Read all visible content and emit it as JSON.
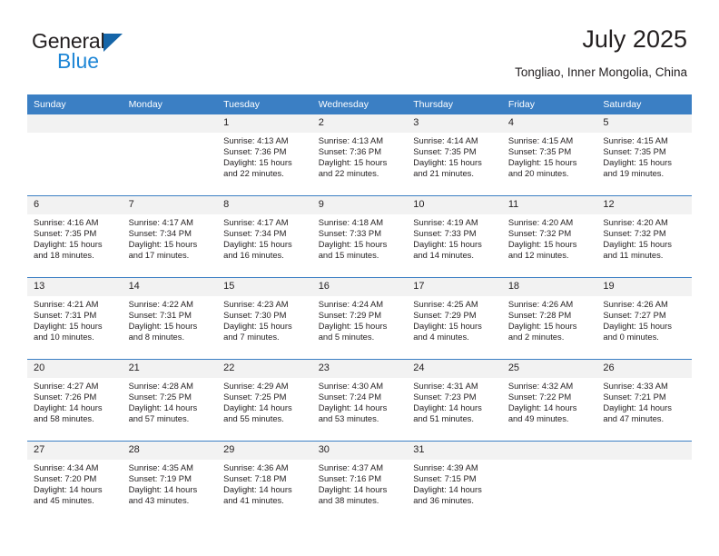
{
  "brand": {
    "name_part1": "General",
    "name_part2": "Blue",
    "logo_icon": "triangle-logo-icon",
    "accent_color": "#1e86d6",
    "triangle_color": "#1565a8"
  },
  "header": {
    "title": "July 2025",
    "subtitle": "Tongliao, Inner Mongolia, China"
  },
  "calendar": {
    "header_bg": "#3b7fc4",
    "daynum_bg": "#f2f2f2",
    "weekdays": [
      "Sunday",
      "Monday",
      "Tuesday",
      "Wednesday",
      "Thursday",
      "Friday",
      "Saturday"
    ],
    "weeks": [
      [
        {
          "day": "",
          "sunrise": "",
          "sunset": "",
          "daylight_line1": "",
          "daylight_line2": ""
        },
        {
          "day": "",
          "sunrise": "",
          "sunset": "",
          "daylight_line1": "",
          "daylight_line2": ""
        },
        {
          "day": "1",
          "sunrise": "Sunrise: 4:13 AM",
          "sunset": "Sunset: 7:36 PM",
          "daylight_line1": "Daylight: 15 hours",
          "daylight_line2": "and 22 minutes."
        },
        {
          "day": "2",
          "sunrise": "Sunrise: 4:13 AM",
          "sunset": "Sunset: 7:36 PM",
          "daylight_line1": "Daylight: 15 hours",
          "daylight_line2": "and 22 minutes."
        },
        {
          "day": "3",
          "sunrise": "Sunrise: 4:14 AM",
          "sunset": "Sunset: 7:35 PM",
          "daylight_line1": "Daylight: 15 hours",
          "daylight_line2": "and 21 minutes."
        },
        {
          "day": "4",
          "sunrise": "Sunrise: 4:15 AM",
          "sunset": "Sunset: 7:35 PM",
          "daylight_line1": "Daylight: 15 hours",
          "daylight_line2": "and 20 minutes."
        },
        {
          "day": "5",
          "sunrise": "Sunrise: 4:15 AM",
          "sunset": "Sunset: 7:35 PM",
          "daylight_line1": "Daylight: 15 hours",
          "daylight_line2": "and 19 minutes."
        }
      ],
      [
        {
          "day": "6",
          "sunrise": "Sunrise: 4:16 AM",
          "sunset": "Sunset: 7:35 PM",
          "daylight_line1": "Daylight: 15 hours",
          "daylight_line2": "and 18 minutes."
        },
        {
          "day": "7",
          "sunrise": "Sunrise: 4:17 AM",
          "sunset": "Sunset: 7:34 PM",
          "daylight_line1": "Daylight: 15 hours",
          "daylight_line2": "and 17 minutes."
        },
        {
          "day": "8",
          "sunrise": "Sunrise: 4:17 AM",
          "sunset": "Sunset: 7:34 PM",
          "daylight_line1": "Daylight: 15 hours",
          "daylight_line2": "and 16 minutes."
        },
        {
          "day": "9",
          "sunrise": "Sunrise: 4:18 AM",
          "sunset": "Sunset: 7:33 PM",
          "daylight_line1": "Daylight: 15 hours",
          "daylight_line2": "and 15 minutes."
        },
        {
          "day": "10",
          "sunrise": "Sunrise: 4:19 AM",
          "sunset": "Sunset: 7:33 PM",
          "daylight_line1": "Daylight: 15 hours",
          "daylight_line2": "and 14 minutes."
        },
        {
          "day": "11",
          "sunrise": "Sunrise: 4:20 AM",
          "sunset": "Sunset: 7:32 PM",
          "daylight_line1": "Daylight: 15 hours",
          "daylight_line2": "and 12 minutes."
        },
        {
          "day": "12",
          "sunrise": "Sunrise: 4:20 AM",
          "sunset": "Sunset: 7:32 PM",
          "daylight_line1": "Daylight: 15 hours",
          "daylight_line2": "and 11 minutes."
        }
      ],
      [
        {
          "day": "13",
          "sunrise": "Sunrise: 4:21 AM",
          "sunset": "Sunset: 7:31 PM",
          "daylight_line1": "Daylight: 15 hours",
          "daylight_line2": "and 10 minutes."
        },
        {
          "day": "14",
          "sunrise": "Sunrise: 4:22 AM",
          "sunset": "Sunset: 7:31 PM",
          "daylight_line1": "Daylight: 15 hours",
          "daylight_line2": "and 8 minutes."
        },
        {
          "day": "15",
          "sunrise": "Sunrise: 4:23 AM",
          "sunset": "Sunset: 7:30 PM",
          "daylight_line1": "Daylight: 15 hours",
          "daylight_line2": "and 7 minutes."
        },
        {
          "day": "16",
          "sunrise": "Sunrise: 4:24 AM",
          "sunset": "Sunset: 7:29 PM",
          "daylight_line1": "Daylight: 15 hours",
          "daylight_line2": "and 5 minutes."
        },
        {
          "day": "17",
          "sunrise": "Sunrise: 4:25 AM",
          "sunset": "Sunset: 7:29 PM",
          "daylight_line1": "Daylight: 15 hours",
          "daylight_line2": "and 4 minutes."
        },
        {
          "day": "18",
          "sunrise": "Sunrise: 4:26 AM",
          "sunset": "Sunset: 7:28 PM",
          "daylight_line1": "Daylight: 15 hours",
          "daylight_line2": "and 2 minutes."
        },
        {
          "day": "19",
          "sunrise": "Sunrise: 4:26 AM",
          "sunset": "Sunset: 7:27 PM",
          "daylight_line1": "Daylight: 15 hours",
          "daylight_line2": "and 0 minutes."
        }
      ],
      [
        {
          "day": "20",
          "sunrise": "Sunrise: 4:27 AM",
          "sunset": "Sunset: 7:26 PM",
          "daylight_line1": "Daylight: 14 hours",
          "daylight_line2": "and 58 minutes."
        },
        {
          "day": "21",
          "sunrise": "Sunrise: 4:28 AM",
          "sunset": "Sunset: 7:25 PM",
          "daylight_line1": "Daylight: 14 hours",
          "daylight_line2": "and 57 minutes."
        },
        {
          "day": "22",
          "sunrise": "Sunrise: 4:29 AM",
          "sunset": "Sunset: 7:25 PM",
          "daylight_line1": "Daylight: 14 hours",
          "daylight_line2": "and 55 minutes."
        },
        {
          "day": "23",
          "sunrise": "Sunrise: 4:30 AM",
          "sunset": "Sunset: 7:24 PM",
          "daylight_line1": "Daylight: 14 hours",
          "daylight_line2": "and 53 minutes."
        },
        {
          "day": "24",
          "sunrise": "Sunrise: 4:31 AM",
          "sunset": "Sunset: 7:23 PM",
          "daylight_line1": "Daylight: 14 hours",
          "daylight_line2": "and 51 minutes."
        },
        {
          "day": "25",
          "sunrise": "Sunrise: 4:32 AM",
          "sunset": "Sunset: 7:22 PM",
          "daylight_line1": "Daylight: 14 hours",
          "daylight_line2": "and 49 minutes."
        },
        {
          "day": "26",
          "sunrise": "Sunrise: 4:33 AM",
          "sunset": "Sunset: 7:21 PM",
          "daylight_line1": "Daylight: 14 hours",
          "daylight_line2": "and 47 minutes."
        }
      ],
      [
        {
          "day": "27",
          "sunrise": "Sunrise: 4:34 AM",
          "sunset": "Sunset: 7:20 PM",
          "daylight_line1": "Daylight: 14 hours",
          "daylight_line2": "and 45 minutes."
        },
        {
          "day": "28",
          "sunrise": "Sunrise: 4:35 AM",
          "sunset": "Sunset: 7:19 PM",
          "daylight_line1": "Daylight: 14 hours",
          "daylight_line2": "and 43 minutes."
        },
        {
          "day": "29",
          "sunrise": "Sunrise: 4:36 AM",
          "sunset": "Sunset: 7:18 PM",
          "daylight_line1": "Daylight: 14 hours",
          "daylight_line2": "and 41 minutes."
        },
        {
          "day": "30",
          "sunrise": "Sunrise: 4:37 AM",
          "sunset": "Sunset: 7:16 PM",
          "daylight_line1": "Daylight: 14 hours",
          "daylight_line2": "and 38 minutes."
        },
        {
          "day": "31",
          "sunrise": "Sunrise: 4:39 AM",
          "sunset": "Sunset: 7:15 PM",
          "daylight_line1": "Daylight: 14 hours",
          "daylight_line2": "and 36 minutes."
        },
        {
          "day": "",
          "sunrise": "",
          "sunset": "",
          "daylight_line1": "",
          "daylight_line2": ""
        },
        {
          "day": "",
          "sunrise": "",
          "sunset": "",
          "daylight_line1": "",
          "daylight_line2": ""
        }
      ]
    ]
  }
}
